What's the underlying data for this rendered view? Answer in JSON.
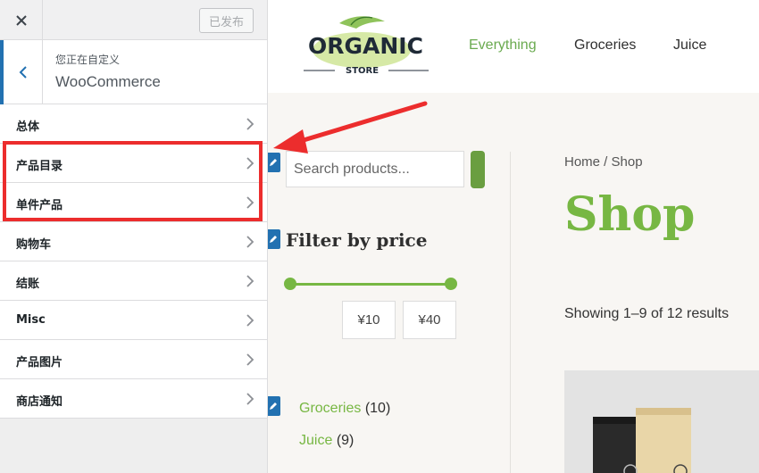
{
  "sidebar": {
    "publish_label": "已发布",
    "context_small": "您正在自定义",
    "context_title": "WooCommerce",
    "items": [
      {
        "label": "总体"
      },
      {
        "label": "产品目录"
      },
      {
        "label": "单件产品"
      },
      {
        "label": "购物车"
      },
      {
        "label": "结账"
      },
      {
        "label": "Misc"
      },
      {
        "label": "产品图片"
      },
      {
        "label": "商店通知"
      }
    ]
  },
  "site": {
    "logo_text": "ORGANIC",
    "logo_subtext": "STORE",
    "nav": [
      "Everything",
      "Groceries",
      "Juice"
    ]
  },
  "shop": {
    "search_placeholder": "Search products...",
    "filter_title": "Filter by price",
    "price_min": "¥10",
    "price_max": "¥40",
    "categories": [
      {
        "name": "Groceries",
        "count": "(10)"
      },
      {
        "name": "Juice",
        "count": "(9)"
      }
    ],
    "breadcrumb": "Home / Shop",
    "title": "Shop",
    "results": "Showing 1–9 of 12 results"
  },
  "colors": {
    "accent_green": "#77b743",
    "customizer_blue": "#2271b1",
    "highlight_red": "#ec2d2d"
  },
  "icons": {
    "close": "close-icon",
    "back": "chevron-left-icon",
    "item_chevron": "chevron-right-icon",
    "edit": "pencil-icon"
  }
}
